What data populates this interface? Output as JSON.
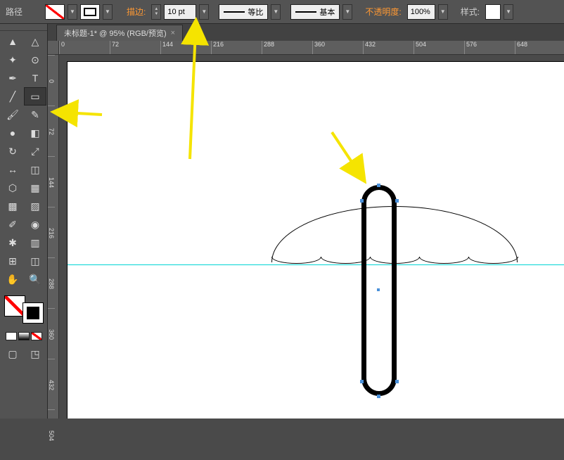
{
  "topbar": {
    "mode": "路径",
    "stroke_label": "描边:",
    "stroke_weight": "10 pt",
    "profile": "等比",
    "brush": "基本",
    "opacity_label": "不透明度:",
    "opacity_value": "100%",
    "style_label": "样式:"
  },
  "tab": {
    "title": "未标题-1* @ 95% (RGB/预览)",
    "close": "×"
  },
  "ruler_h": [
    "0",
    "72",
    "144",
    "216",
    "288",
    "360",
    "432",
    "504",
    "576",
    "648"
  ],
  "ruler_v": [
    "0",
    "72",
    "144",
    "216",
    "288",
    "360",
    "432",
    "504"
  ],
  "tools": [
    {
      "name": "selection",
      "glyph": "▲"
    },
    {
      "name": "direct-selection",
      "glyph": "△"
    },
    {
      "name": "magic-wand",
      "glyph": "✦"
    },
    {
      "name": "lasso",
      "glyph": "⊙"
    },
    {
      "name": "pen",
      "glyph": "✒"
    },
    {
      "name": "type",
      "glyph": "T"
    },
    {
      "name": "line",
      "glyph": "╱"
    },
    {
      "name": "rectangle",
      "glyph": "▭",
      "active": true
    },
    {
      "name": "paintbrush",
      "glyph": "🖌"
    },
    {
      "name": "pencil",
      "glyph": "✎"
    },
    {
      "name": "blob",
      "glyph": "●"
    },
    {
      "name": "eraser",
      "glyph": "◧"
    },
    {
      "name": "rotate",
      "glyph": "↻"
    },
    {
      "name": "scale",
      "glyph": "⤢"
    },
    {
      "name": "width",
      "glyph": "↔"
    },
    {
      "name": "free-transform",
      "glyph": "◫"
    },
    {
      "name": "shape-builder",
      "glyph": "⬡"
    },
    {
      "name": "perspective",
      "glyph": "▦"
    },
    {
      "name": "mesh",
      "glyph": "▩"
    },
    {
      "name": "gradient",
      "glyph": "▨"
    },
    {
      "name": "eyedropper",
      "glyph": "✐"
    },
    {
      "name": "blend",
      "glyph": "◉"
    },
    {
      "name": "symbol-sprayer",
      "glyph": "✱"
    },
    {
      "name": "column-graph",
      "glyph": "▥"
    },
    {
      "name": "artboard",
      "glyph": "⊞"
    },
    {
      "name": "slice",
      "glyph": "◫"
    },
    {
      "name": "hand",
      "glyph": "✋"
    },
    {
      "name": "zoom",
      "glyph": "🔍"
    }
  ],
  "bottom_tools": [
    {
      "name": "screen-mode",
      "glyph": "▢"
    },
    {
      "name": "change-screen",
      "glyph": "◳"
    }
  ]
}
